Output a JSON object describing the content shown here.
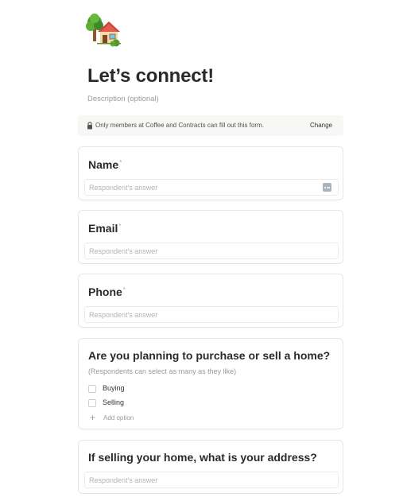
{
  "form": {
    "emoji_icon": "house-with-tree-icon",
    "title": "Let’s connect!",
    "description_placeholder": "Description (optional)"
  },
  "notice": {
    "icon": "lock-icon",
    "text": "Only members at Coffee and Contracts can fill out this form.",
    "change_label": "Change"
  },
  "questions": [
    {
      "title": "Name",
      "required_mark": "*",
      "placeholder": "Respondent's answer"
    },
    {
      "title": "Email",
      "required_mark": "*",
      "placeholder": "Respondent's answer"
    },
    {
      "title": "Phone",
      "required_mark": "*",
      "placeholder": "Respondent's answer"
    },
    {
      "title": "Are you planning to purchase or sell a home?",
      "helper": "(Respondents can select as many as they like)",
      "options": [
        "Buying",
        "Selling"
      ],
      "add_option_label": "Add option"
    },
    {
      "title": "If selling your home, what is your address?",
      "placeholder": "Respondent's answer"
    }
  ],
  "colors": {
    "card_border": "#dde9ef",
    "notice_bg": "#f7f7f5",
    "placeholder": "#b4b3b0"
  }
}
